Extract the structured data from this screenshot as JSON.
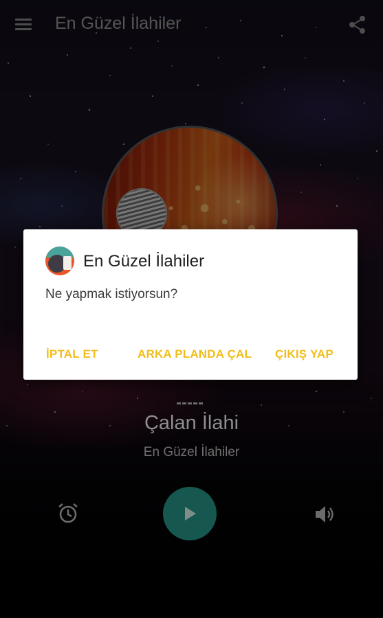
{
  "app_bar": {
    "title": "En Güzel İlahiler",
    "menu_icon": "hamburger-menu-icon",
    "share_icon": "share-icon"
  },
  "now_playing": {
    "song_title": "Çalan İlahi",
    "artist": "En Güzel İlahiler",
    "separator": "---"
  },
  "controls": {
    "alarm_icon": "alarm-clock-icon",
    "play_icon": "play-icon",
    "volume_icon": "volume-icon"
  },
  "dialog": {
    "title": "En Güzel İlahiler",
    "message": "Ne yapmak istiyorsun?",
    "buttons": {
      "cancel": "İPTAL ET",
      "background": "ARKA PLANDA ÇAL",
      "exit": "ÇIKIŞ YAP"
    }
  },
  "colors": {
    "accent": "#f2bd1a",
    "play_button": "#16584f",
    "dialog_background": "#ffffff"
  }
}
